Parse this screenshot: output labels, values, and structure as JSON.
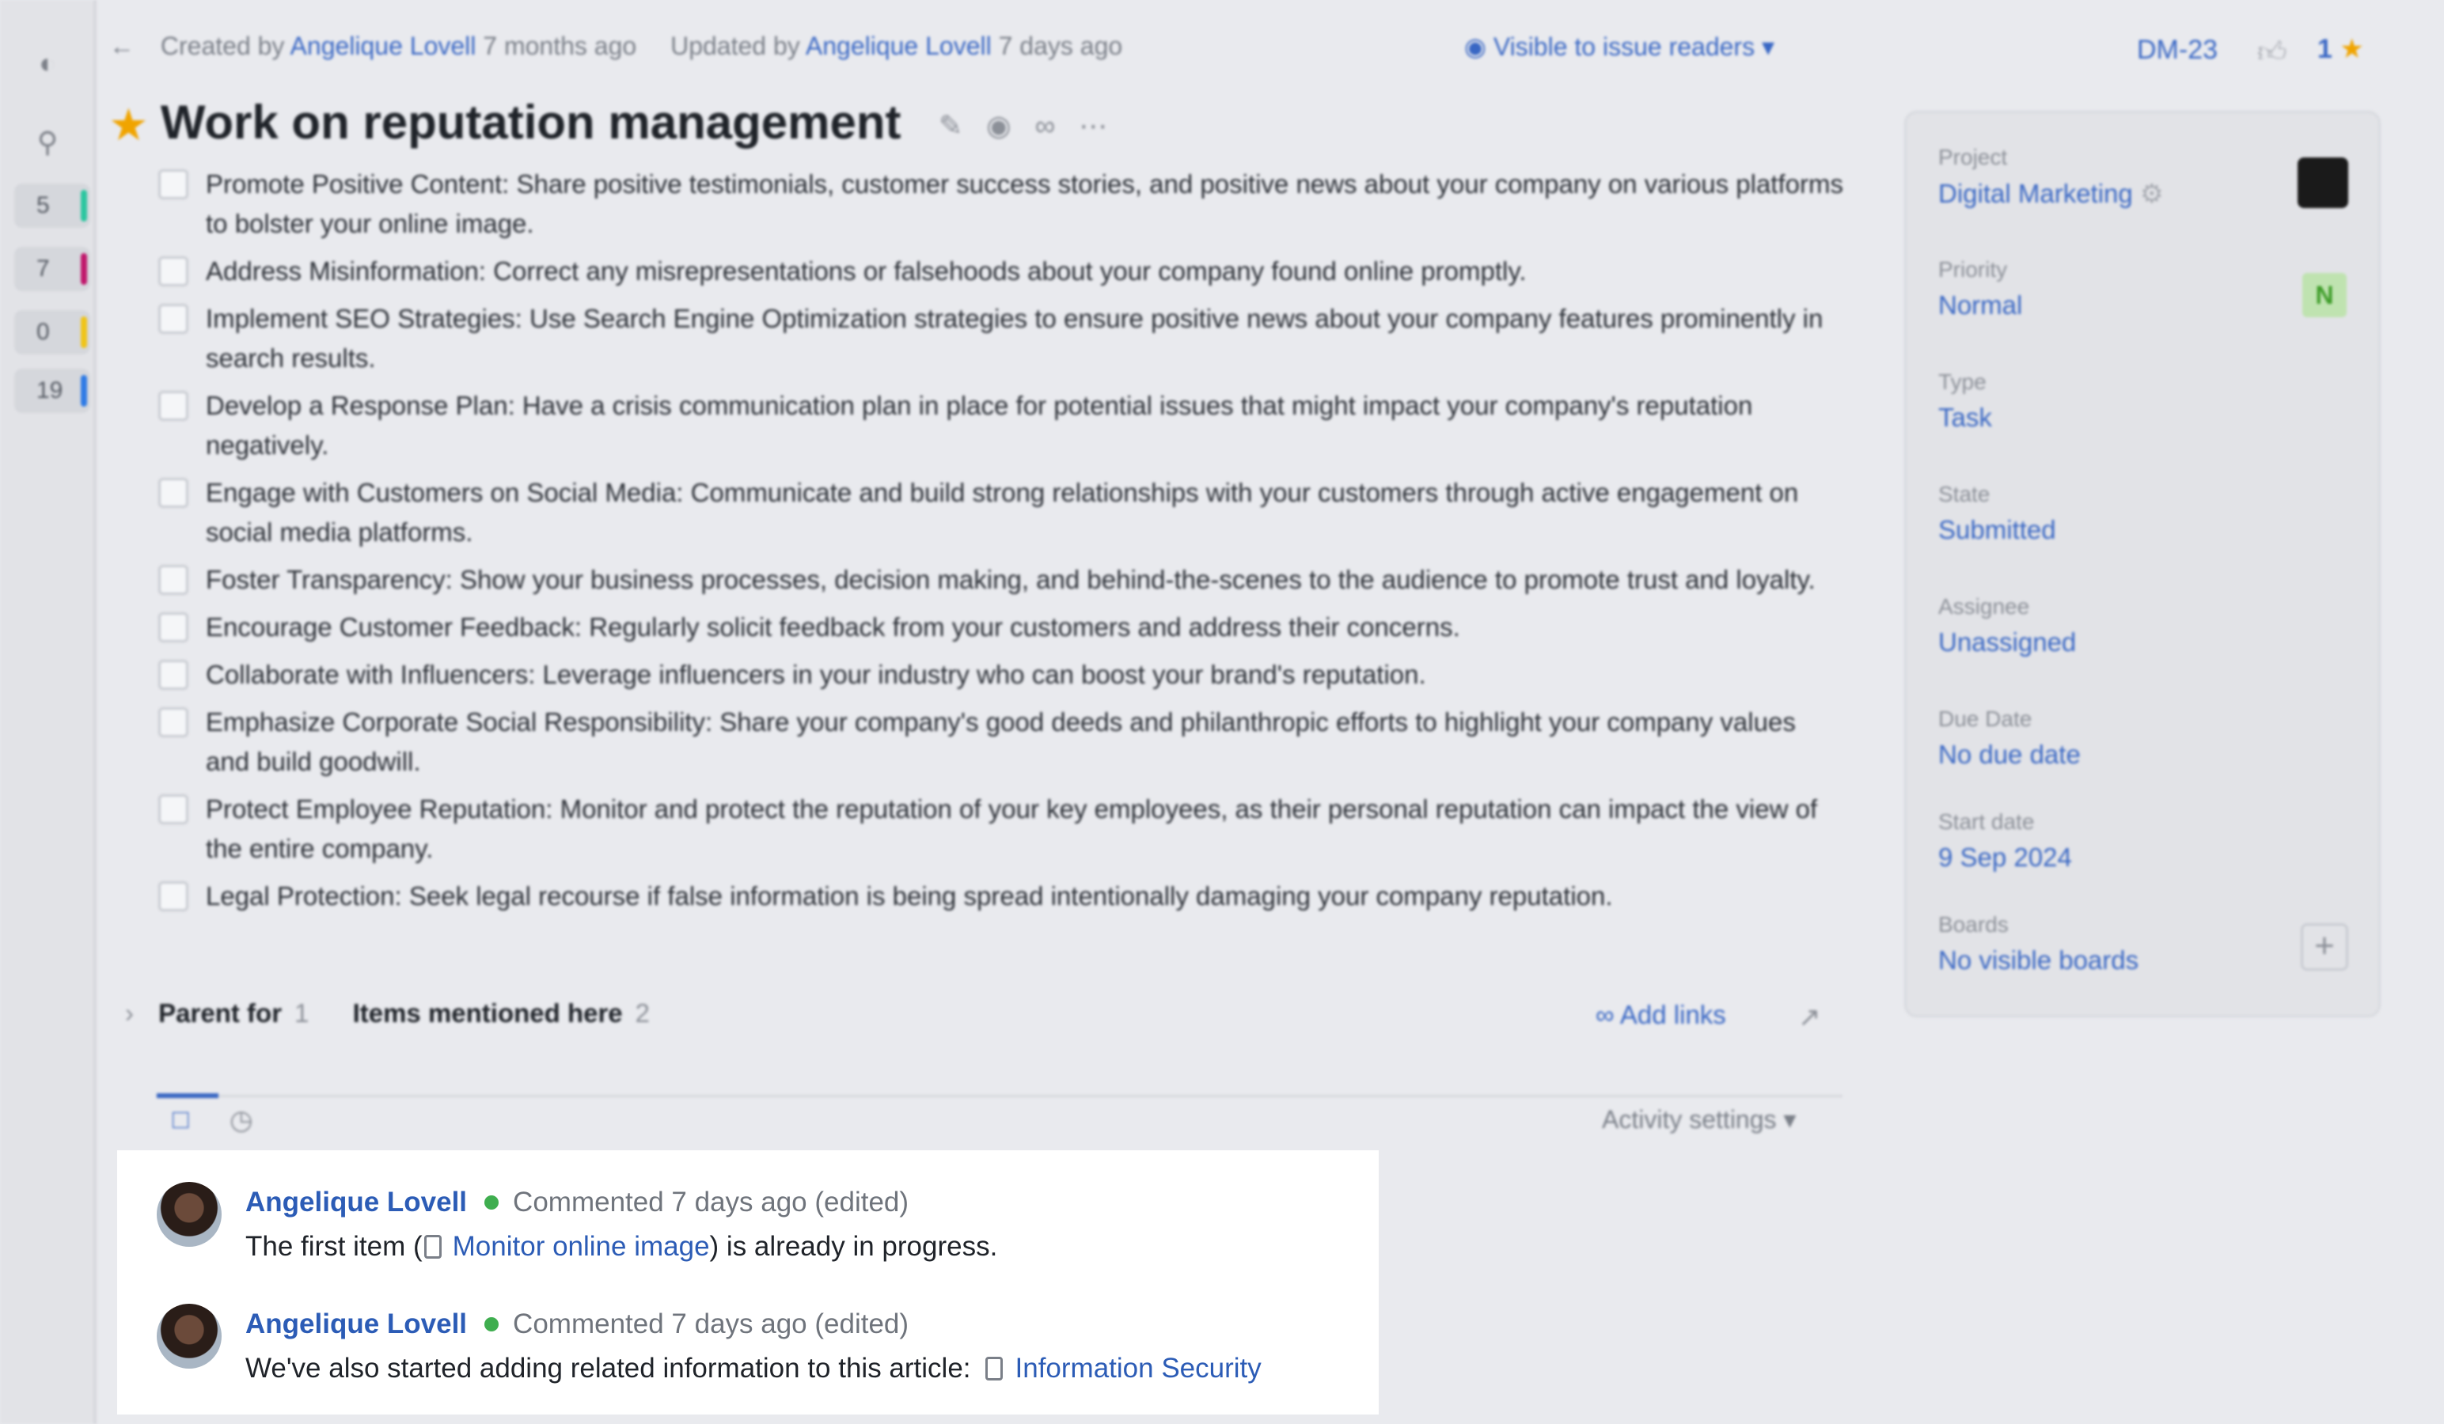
{
  "sidebar": {
    "icons": [
      "logo-icon",
      "search-icon"
    ],
    "counts": [
      {
        "value": "5",
        "color": "#2cc6a0"
      },
      {
        "value": "7",
        "color": "#c0186c"
      },
      {
        "value": "0",
        "color": "#f0c419"
      },
      {
        "value": "19",
        "color": "#2f7be5"
      }
    ]
  },
  "header": {
    "created_prefix": "Created by",
    "created_by": "Angelique Lovell",
    "created_ago": "7 months ago",
    "updated_prefix": "Updated by",
    "updated_by": "Angelique Lovell",
    "updated_ago": "7 days ago",
    "visibility": "Visible to issue readers",
    "issue_id": "DM-23",
    "star_count": "1"
  },
  "issue": {
    "title": "Work on reputation management",
    "checklist": [
      "Promote Positive Content: Share positive testimonials, customer success stories, and positive news about your company on various platforms to bolster your online image.",
      "Address Misinformation: Correct any misrepresentations or falsehoods about your company found online promptly.",
      "Implement SEO Strategies: Use Search Engine Optimization strategies to ensure positive news about your company features prominently in search results.",
      "Develop a Response Plan: Have a crisis communication plan in place for potential issues that might impact your company's reputation negatively.",
      "Engage with Customers on Social Media: Communicate and build strong relationships with your customers through active engagement on social media platforms.",
      "Foster Transparency: Show your business processes, decision making, and behind-the-scenes to the audience to promote trust and loyalty.",
      "Encourage Customer Feedback: Regularly solicit feedback from your customers and address their concerns.",
      "Collaborate with Influencers: Leverage influencers in your industry who can boost your brand's reputation.",
      "Emphasize Corporate Social Responsibility: Share your company's good deeds and philanthropic efforts to highlight your company values and build goodwill.",
      "Protect Employee Reputation: Monitor and protect the reputation of your key employees, as their personal reputation can impact the view of the entire company.",
      "Legal Protection: Seek legal recourse if false information is being spread intentionally damaging your company reputation."
    ]
  },
  "relations": {
    "parent_label": "Parent for",
    "parent_count": "1",
    "mentioned_label": "Items mentioned here",
    "mentioned_count": "2",
    "add_links": "Add links"
  },
  "activity": {
    "settings_label": "Activity settings"
  },
  "fields": {
    "project": {
      "label": "Project",
      "value": "Digital Marketing"
    },
    "priority": {
      "label": "Priority",
      "value": "Normal",
      "badge": "N"
    },
    "type": {
      "label": "Type",
      "value": "Task"
    },
    "state": {
      "label": "State",
      "value": "Submitted"
    },
    "assignee": {
      "label": "Assignee",
      "value": "Unassigned"
    },
    "due_date": {
      "label": "Due Date",
      "value": "No due date"
    },
    "start_date": {
      "label": "Start date",
      "value": "9 Sep 2024"
    },
    "boards": {
      "label": "Boards",
      "value": "No visible boards"
    }
  },
  "comments": [
    {
      "author": "Angelique Lovell",
      "meta": "Commented 7 days ago (edited)",
      "body_before": "The first item (",
      "link": "Monitor online image",
      "body_after": ") is already in progress."
    },
    {
      "author": "Angelique Lovell",
      "meta": "Commented 7 days ago (edited)",
      "body_before": "We've also started adding related information to this article:",
      "link": "Information Security",
      "body_after": ""
    }
  ]
}
